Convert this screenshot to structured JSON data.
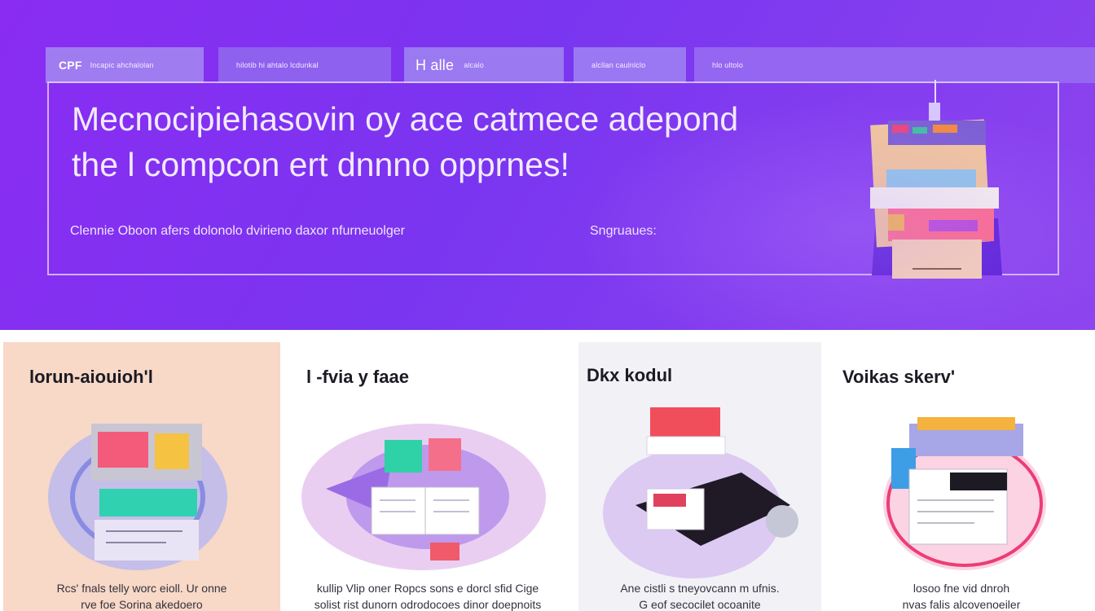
{
  "nav": {
    "tabs": [
      {
        "logo": "CPF",
        "label": "Incapic ahchalolan"
      },
      {
        "label": "hilotib hi ahtalo lcdunkal"
      },
      {
        "big": "H alle",
        "label": "alcalo"
      },
      {
        "label": "alcllan caulnlclo"
      },
      {
        "label": "hlo ultolo"
      }
    ]
  },
  "hero": {
    "headline_line1": "Mecnocipiehasovin oy ace catmece adepond",
    "headline_line2": "the l compcon ert dnnno opprnes!",
    "subline": "Clennie Oboon afers dolonolo dvirieno daxor nfurneuolger",
    "signature": "Sngruaues:"
  },
  "cards": [
    {
      "title": "lorun-aiouioh'l",
      "desc_line1": "Rcs' fnals telly worc eioll. Ur onne",
      "desc_line2": "rve foe Sorina akedoero"
    },
    {
      "title": "l -fvia y faae",
      "desc_line1": "kullip Vlip oner Ropcs sons e dorcl sfid Cige",
      "desc_line2": "solist rist dunorn odrodocoes dinor doepnoits"
    },
    {
      "title": "Dkx kodul",
      "desc_line1": "Ane cistli s tneyovcann m ufnis.",
      "desc_line2": "G eof secocilet ocoanite"
    },
    {
      "title": "Voikas skerv'",
      "desc_line1": "losoo fne vid dnroh",
      "desc_line2": "nvas falis alcovenoeiler"
    }
  ],
  "colors": {
    "hero_start": "#8a2cf2",
    "hero_end": "#8d45ee",
    "card1_bg": "#f8d8c6",
    "card3_bg": "#f2f1f6"
  }
}
